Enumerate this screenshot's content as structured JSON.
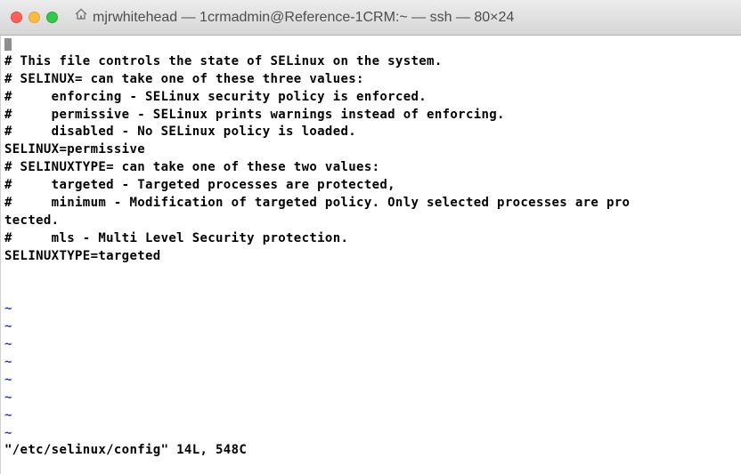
{
  "window": {
    "title": "mjrwhitehead — 1crmadmin@Reference-1CRM:~ — ssh — 80×24",
    "title_icon": "home-icon"
  },
  "terminal": {
    "lines": [
      "# This file controls the state of SELinux on the system.",
      "# SELINUX= can take one of these three values:",
      "#     enforcing - SELinux security policy is enforced.",
      "#     permissive - SELinux prints warnings instead of enforcing.",
      "#     disabled - No SELinux policy is loaded.",
      "SELINUX=permissive",
      "# SELINUXTYPE= can take one of these two values:",
      "#     targeted - Targeted processes are protected,",
      "#     minimum - Modification of targeted policy. Only selected processes are pro",
      "tected.",
      "#     mls - Multi Level Security protection.",
      "SELINUXTYPE=targeted",
      "",
      "",
      "~",
      "~",
      "~",
      "~",
      "~",
      "~",
      "~",
      "~",
      "\"/etc/selinux/config\" 14L, 548C"
    ],
    "tilde_color": "#1f3fd8"
  }
}
